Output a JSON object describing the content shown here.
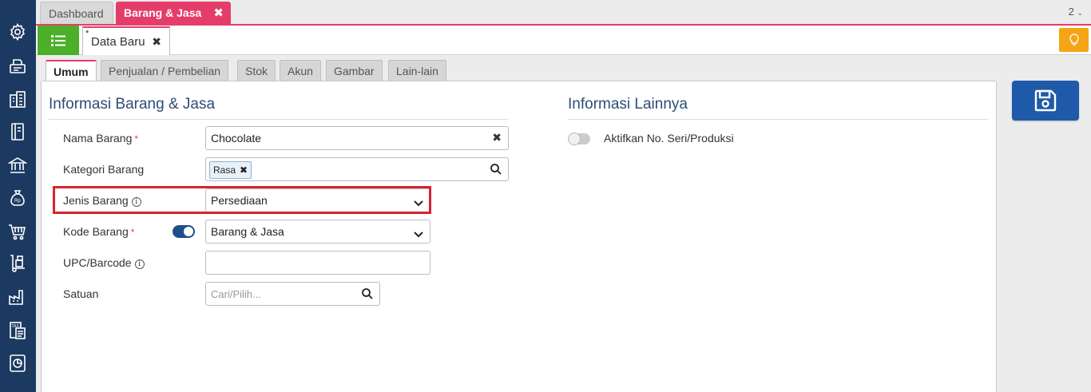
{
  "top_tabs": [
    {
      "label": "Dashboard"
    },
    {
      "label": "Barang & Jasa",
      "close": "✖"
    }
  ],
  "page_count": "2",
  "doc_tab": {
    "modified_mark": "*",
    "label": "Data Baru",
    "close": "✖"
  },
  "content_tabs": [
    "Umum",
    "Penjualan / Pembelian",
    "Stok",
    "Akun",
    "Gambar",
    "Lain-lain"
  ],
  "section_left": {
    "title": "Informasi Barang & Jasa",
    "fields": {
      "nama_barang": {
        "label": "Nama Barang",
        "required": "*",
        "value": "Chocolate"
      },
      "kategori_barang": {
        "label": "Kategori Barang",
        "chip": "Rasa"
      },
      "jenis_barang": {
        "label": "Jenis Barang",
        "value": "Persediaan"
      },
      "kode_barang": {
        "label": "Kode Barang",
        "required": "*",
        "value": "Barang & Jasa"
      },
      "upc_barcode": {
        "label": "UPC/Barcode",
        "value": ""
      },
      "satuan": {
        "label": "Satuan",
        "placeholder": "Cari/Pilih..."
      }
    }
  },
  "section_right": {
    "title": "Informasi Lainnya",
    "toggle_label": "Aktifkan No. Seri/Produksi"
  },
  "colors": {
    "sidebar": "#1c3a61",
    "accent_pink": "#e53d6a",
    "list_button": "#4caf2a",
    "bulb_button": "#f5a416",
    "save_button": "#1f5aaa",
    "highlight_box": "#d9222f"
  },
  "sidebar_icons": [
    "gear-icon",
    "fax-icon",
    "buildings-icon",
    "notebook-icon",
    "bank-icon",
    "moneybag-icon",
    "cart-icon",
    "hand-truck-icon",
    "factory-icon",
    "tax-icon",
    "report-icon"
  ]
}
